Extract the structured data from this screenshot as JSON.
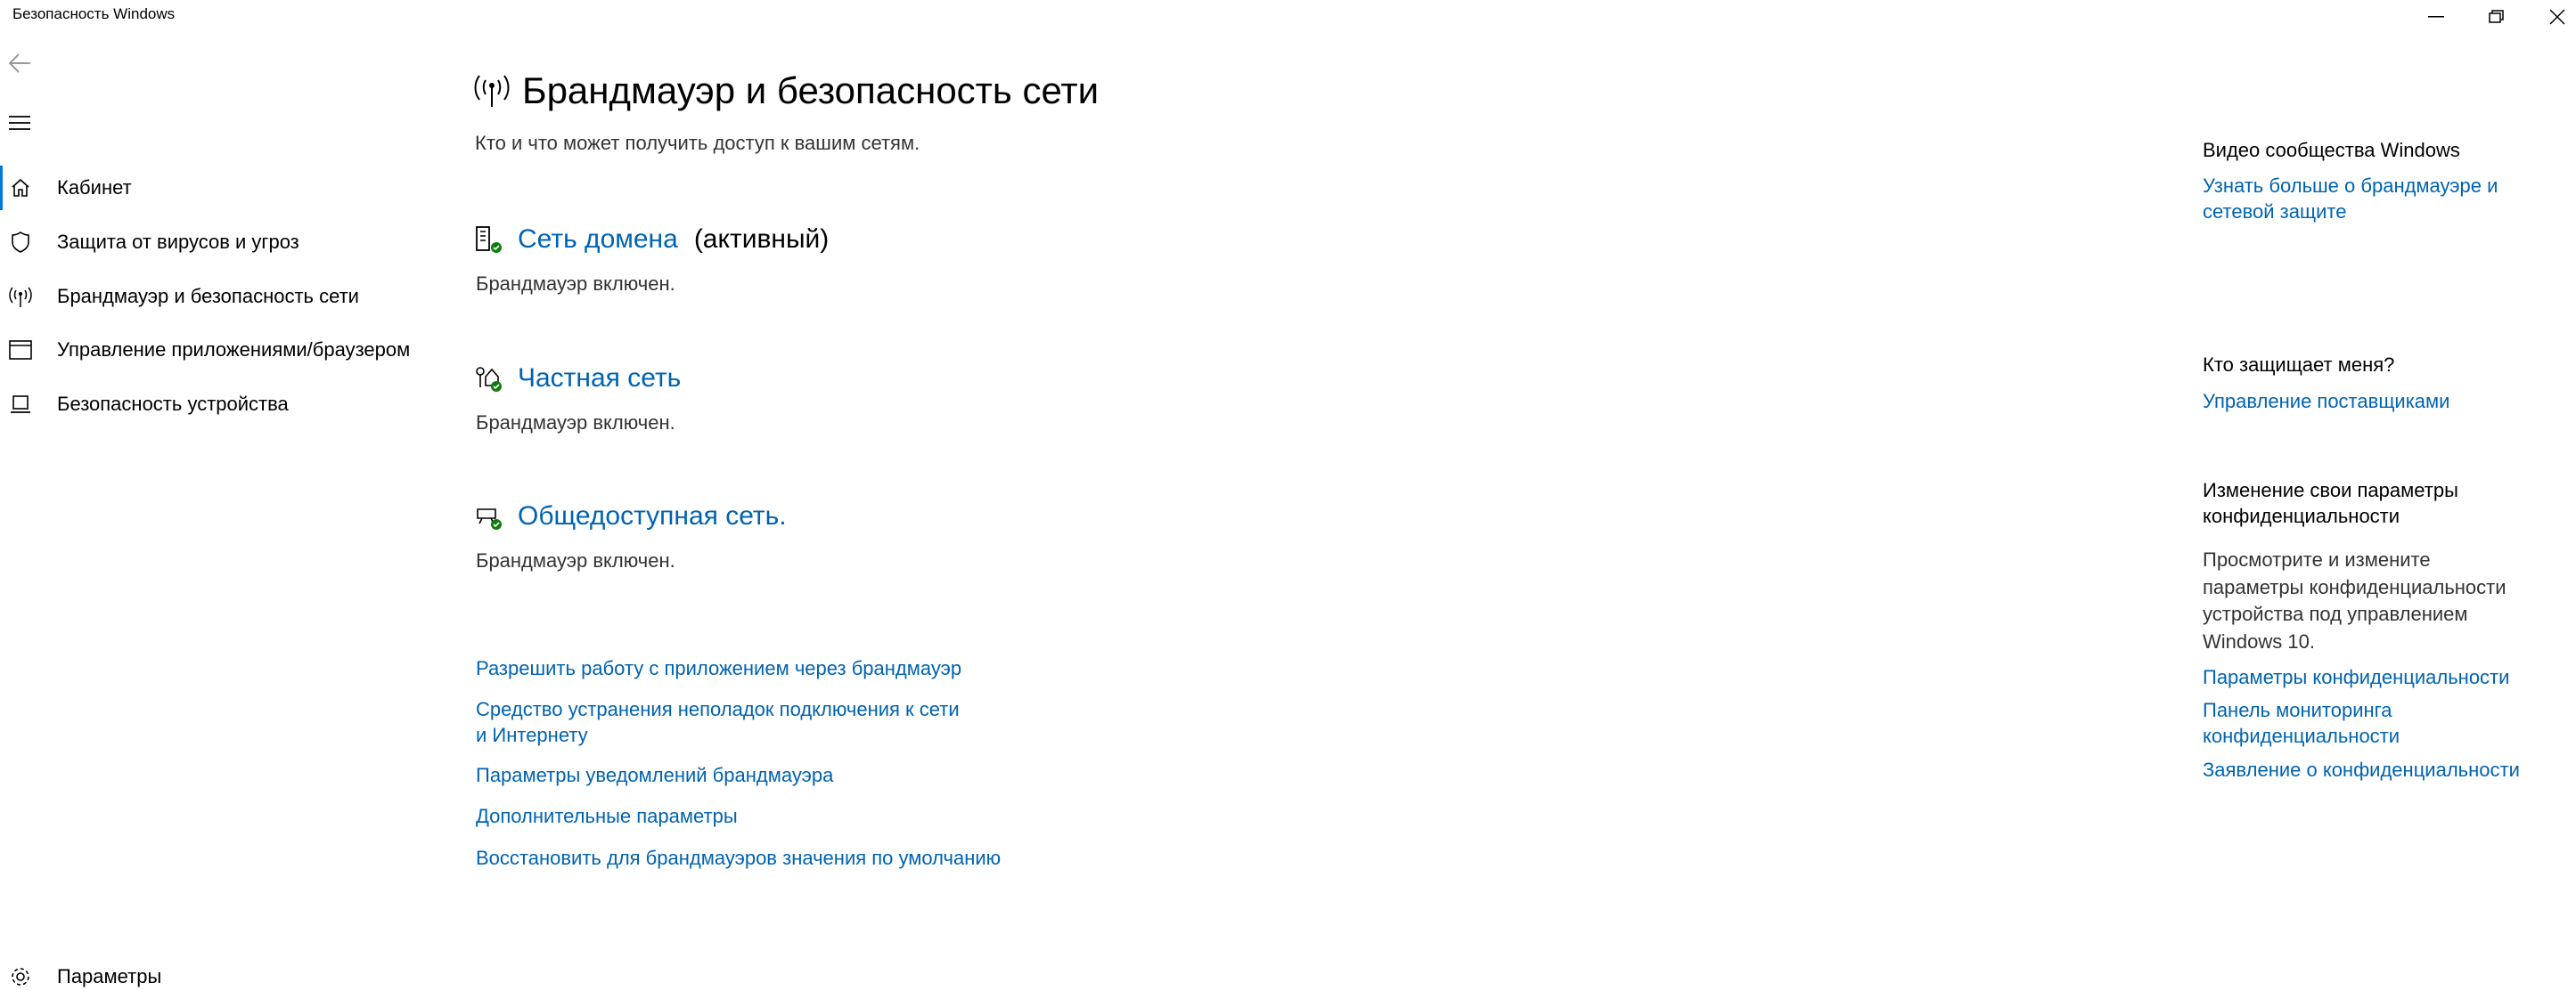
{
  "window": {
    "title": "Безопасность Windows",
    "minimize": "minimize",
    "restore": "restore",
    "close": "close"
  },
  "sidebar": {
    "items": [
      {
        "label": "Кабинет",
        "icon": "home-icon"
      },
      {
        "label": "Защита от вирусов и угроз",
        "icon": "shield-icon"
      },
      {
        "label": "Брандмауэр и безопасность сети",
        "icon": "wifi-antenna-icon"
      },
      {
        "label": "Управление приложениями/браузером",
        "icon": "app-window-icon"
      },
      {
        "label": "Безопасность устройства",
        "icon": "laptop-icon"
      }
    ],
    "settings": "Параметры"
  },
  "main": {
    "title": "Брандмауэр и безопасность сети",
    "subtitle": "Кто и что может получить доступ к вашим сетям.",
    "networks": [
      {
        "name": "Сеть домена",
        "badge": "(активный)",
        "status": "Брандмауэр включен."
      },
      {
        "name": "Частная сеть",
        "badge": "",
        "status": "Брандмауэр включен."
      },
      {
        "name": "Общедоступная сеть.",
        "badge": "",
        "status": "Брандмауэр включен."
      }
    ],
    "links": [
      "Разрешить работу с приложением через брандмауэр",
      "Средство устранения неполадок подключения к сети и Интернету",
      "Параметры уведомлений брандмауэра",
      "Дополнительные параметры",
      "Восстановить для брандмауэров значения по умолчанию"
    ]
  },
  "right": {
    "video_heading": "Видео сообщества Windows",
    "video_link": "Узнать больше о брандмауэре и сетевой защите",
    "who_heading": "Кто защищает меня?",
    "who_link": "Управление поставщиками",
    "privacy_heading": "Изменение свои параметры конфиденциальности",
    "privacy_text": "Просмотрите и измените параметры конфиденциальности устройства под управлением Windows 10.",
    "privacy_links": [
      "Параметры конфиденциальности",
      "Панель мониторинга конфиденциальности",
      "Заявление о конфиденциальности"
    ]
  },
  "colors": {
    "link": "#0063b1",
    "accent": "#0078d7",
    "ok": "#107c10"
  }
}
